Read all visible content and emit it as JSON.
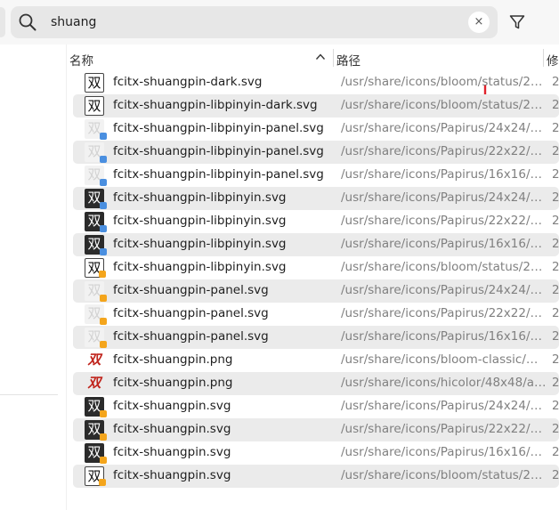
{
  "search": {
    "value": "shuang",
    "clear_label": "×"
  },
  "columns": {
    "name": "名称",
    "path": "路径",
    "modified": "修"
  },
  "colors": {
    "search_bg": "#e7e7e7",
    "row_alt": "#ebebeb",
    "path_text": "#808080",
    "arrow": "#e0222b"
  },
  "files": [
    {
      "name": "fcitx-shuangpin-dark.svg",
      "path": "/usr/share/icons/bloom/status/2…",
      "modified": "2",
      "icon": "shuang-light-icon",
      "glyph": "双",
      "style": "light",
      "badge": ""
    },
    {
      "name": "fcitx-shuangpin-libpinyin-dark.svg",
      "path": "/usr/share/icons/bloom/status/2…",
      "modified": "2",
      "icon": "shuang-light-icon",
      "glyph": "双",
      "style": "light",
      "badge": ""
    },
    {
      "name": "fcitx-shuangpin-libpinyin-panel.svg",
      "path": "/usr/share/icons/Papirus/24x24/…",
      "modified": "2",
      "icon": "shuang-ghost-icon",
      "glyph": "双",
      "style": "ghost",
      "badge": "blue"
    },
    {
      "name": "fcitx-shuangpin-libpinyin-panel.svg",
      "path": "/usr/share/icons/Papirus/22x22/…",
      "modified": "2",
      "icon": "shuang-ghost-icon",
      "glyph": "双",
      "style": "ghost",
      "badge": "blue"
    },
    {
      "name": "fcitx-shuangpin-libpinyin-panel.svg",
      "path": "/usr/share/icons/Papirus/16x16/…",
      "modified": "2",
      "icon": "shuang-ghost-icon",
      "glyph": "双",
      "style": "ghost",
      "badge": "blue"
    },
    {
      "name": "fcitx-shuangpin-libpinyin.svg",
      "path": "/usr/share/icons/Papirus/24x24/…",
      "modified": "2",
      "icon": "shuang-dark-icon",
      "glyph": "双",
      "style": "dark",
      "badge": "blue"
    },
    {
      "name": "fcitx-shuangpin-libpinyin.svg",
      "path": "/usr/share/icons/Papirus/22x22/…",
      "modified": "2",
      "icon": "shuang-dark-icon",
      "glyph": "双",
      "style": "dark",
      "badge": "blue"
    },
    {
      "name": "fcitx-shuangpin-libpinyin.svg",
      "path": "/usr/share/icons/Papirus/16x16/…",
      "modified": "2",
      "icon": "shuang-dark-icon",
      "glyph": "双",
      "style": "dark",
      "badge": "blue"
    },
    {
      "name": "fcitx-shuangpin-libpinyin.svg",
      "path": "/usr/share/icons/bloom/status/2…",
      "modified": "2",
      "icon": "shuang-light-icon",
      "glyph": "双",
      "style": "light",
      "badge": "orange"
    },
    {
      "name": "fcitx-shuangpin-panel.svg",
      "path": "/usr/share/icons/Papirus/24x24/…",
      "modified": "2",
      "icon": "shuang-ghost-icon",
      "glyph": "双",
      "style": "ghost",
      "badge": "orange"
    },
    {
      "name": "fcitx-shuangpin-panel.svg",
      "path": "/usr/share/icons/Papirus/22x22/…",
      "modified": "2",
      "icon": "shuang-ghost-icon",
      "glyph": "双",
      "style": "ghost",
      "badge": "orange"
    },
    {
      "name": "fcitx-shuangpin-panel.svg",
      "path": "/usr/share/icons/Papirus/16x16/…",
      "modified": "2",
      "icon": "shuang-ghost-icon",
      "glyph": "双",
      "style": "ghost",
      "badge": "orange"
    },
    {
      "name": "fcitx-shuangpin.png",
      "path": "/usr/share/icons/bloom-classic/…",
      "modified": "2",
      "icon": "shuang-red-icon",
      "glyph": "双",
      "style": "red",
      "badge": ""
    },
    {
      "name": "fcitx-shuangpin.png",
      "path": "/usr/share/icons/hicolor/48x48/a…",
      "modified": "2",
      "icon": "shuang-red-icon",
      "glyph": "双",
      "style": "red",
      "badge": ""
    },
    {
      "name": "fcitx-shuangpin.svg",
      "path": "/usr/share/icons/Papirus/24x24/…",
      "modified": "2",
      "icon": "shuang-dark-icon",
      "glyph": "双",
      "style": "dark",
      "badge": "orange"
    },
    {
      "name": "fcitx-shuangpin.svg",
      "path": "/usr/share/icons/Papirus/22x22/…",
      "modified": "2",
      "icon": "shuang-dark-icon",
      "glyph": "双",
      "style": "dark",
      "badge": "orange"
    },
    {
      "name": "fcitx-shuangpin.svg",
      "path": "/usr/share/icons/Papirus/16x16/…",
      "modified": "2",
      "icon": "shuang-dark-icon",
      "glyph": "双",
      "style": "dark",
      "badge": "orange"
    },
    {
      "name": "fcitx-shuangpin.svg",
      "path": "/usr/share/icons/bloom/status/2…",
      "modified": "2",
      "icon": "shuang-light-icon",
      "glyph": "双",
      "style": "light",
      "badge": "orange"
    }
  ]
}
